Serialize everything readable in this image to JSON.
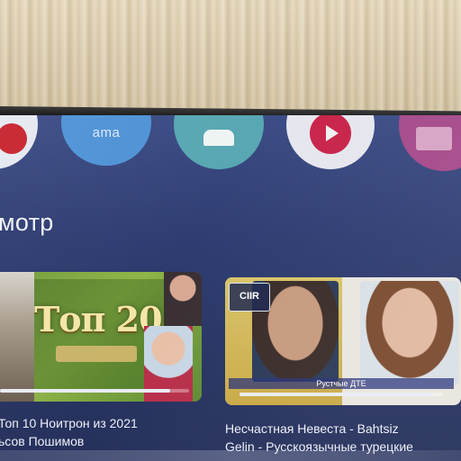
{
  "apps": [
    {
      "name": "youtube-app",
      "label": ""
    },
    {
      "name": "amazon-prime-app",
      "label": "ama"
    },
    {
      "name": "android-app",
      "label": ""
    },
    {
      "name": "media-player-app",
      "label": ""
    },
    {
      "name": "tv-app",
      "label": ""
    }
  ],
  "section": {
    "title": "мотр"
  },
  "videos": [
    {
      "thumb_text": "Топ 20",
      "title_line1": "Топ 10 Ноитрон из 2021",
      "title_line2": "ьсов Пошимов",
      "progress": 0.9
    },
    {
      "thumb_badge": "CIIR",
      "thumb_caption": "Рустчые ДТЕ",
      "title_line1": "Несчастная Невеста - Bahtsiz",
      "title_line2": "Gelin - Русскоязычные турецкие",
      "progress": 0.95
    }
  ],
  "colors": {
    "screen_bg": "#2f3d72",
    "text": "#eef0f7",
    "progress_fill": "#e9ecf4"
  }
}
